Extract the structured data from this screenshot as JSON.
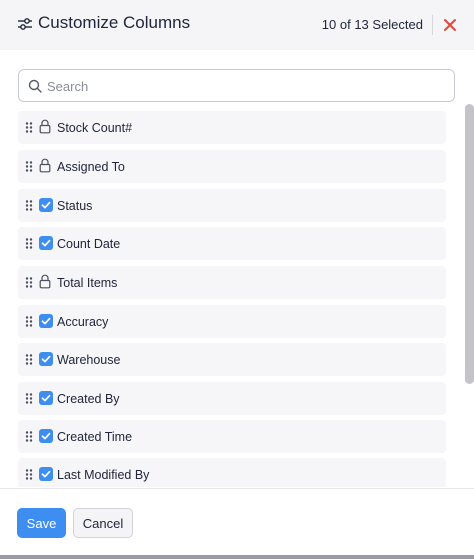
{
  "header": {
    "title": "Customize Columns",
    "selected_count": "10 of 13 Selected",
    "accent_close_color": "#e5483c"
  },
  "search": {
    "placeholder": "Search",
    "value": ""
  },
  "columns": [
    {
      "label": "Stock Count#",
      "state": "locked",
      "icon": "lock-icon"
    },
    {
      "label": "Assigned To",
      "state": "locked",
      "icon": "lock-icon"
    },
    {
      "label": "Status",
      "state": "checked",
      "icon": "checkbox-checked-icon"
    },
    {
      "label": "Count Date",
      "state": "checked",
      "icon": "checkbox-checked-icon"
    },
    {
      "label": "Total Items",
      "state": "locked",
      "icon": "lock-icon"
    },
    {
      "label": "Accuracy",
      "state": "checked",
      "icon": "checkbox-checked-icon"
    },
    {
      "label": "Warehouse",
      "state": "checked",
      "icon": "checkbox-checked-icon"
    },
    {
      "label": "Created By",
      "state": "checked",
      "icon": "checkbox-checked-icon"
    },
    {
      "label": "Created Time",
      "state": "checked",
      "icon": "checkbox-checked-icon"
    },
    {
      "label": "Last Modified By",
      "state": "checked",
      "icon": "checkbox-checked-icon"
    }
  ],
  "footer": {
    "save_label": "Save",
    "cancel_label": "Cancel",
    "save_color": "#3d8ef0"
  }
}
